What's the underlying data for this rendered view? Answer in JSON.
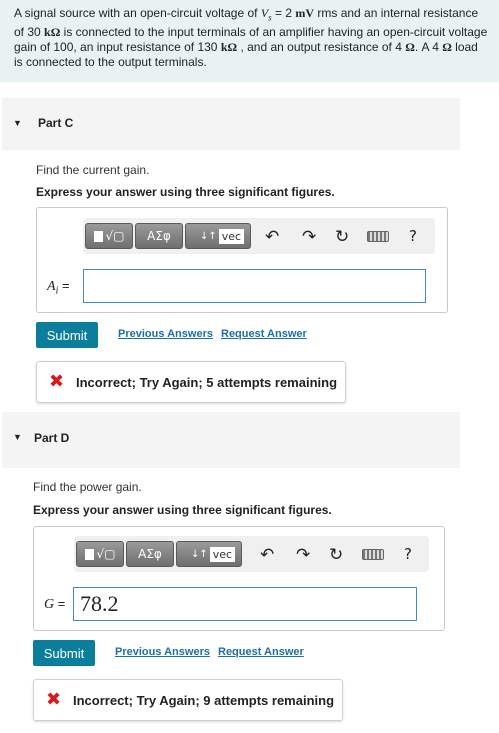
{
  "problem": {
    "t1": "A signal source with an open-circuit voltage of ",
    "v_var": "V",
    "v_sub": "s",
    "t2": " = 2 ",
    "mv": "mV",
    "t3": " rms and an internal resistance of 30 ",
    "kohm1": "kΩ",
    "t4": " is connected to the input terminals of an amplifier having an open-circuit voltage gain of 100, an input resistance of 130 ",
    "kohm2": "kΩ",
    "t5": " , and an output resistance of 4 ",
    "ohm1": "Ω",
    "t6": ". A 4 ",
    "ohm2": "Ω",
    "t7": " load is connected to the output terminals."
  },
  "parts": [
    {
      "caret": "▼",
      "title": "Part C",
      "prompt": "Find the current gain.",
      "instruction": "Express your answer using three significant figures.",
      "var": "A",
      "var_sub": "i",
      "eq": " =",
      "value": "",
      "submit": "Submit",
      "previous": "Previous Answers",
      "request": "Request Answer",
      "feedback_icon": "✖",
      "feedback": "Incorrect; Try Again; 5 attempts remaining"
    },
    {
      "caret": "▼",
      "title": "Part D",
      "prompt": "Find the power gain.",
      "instruction": "Express your answer using three significant figures.",
      "var": "G",
      "var_sub": "",
      "eq": " =",
      "value": "78.2",
      "submit": "Submit",
      "previous": "Previous Answers",
      "request": "Request Answer",
      "feedback_icon": "✖",
      "feedback": "Incorrect; Try Again; 9 attempts remaining"
    }
  ],
  "toolbar": {
    "templates_icon": "√▢",
    "greek": "ΑΣφ",
    "arrows": "↓↑",
    "vec": "vec",
    "undo": "↶",
    "redo": "↷",
    "reset": "↻",
    "help": "?"
  },
  "colors": {
    "problem_bg": "#e8f2f3",
    "submit_bg": "#0b7e9c",
    "link": "#1d6fa7",
    "incorrect": "#d9191b",
    "input_border": "#3a8fc9"
  }
}
